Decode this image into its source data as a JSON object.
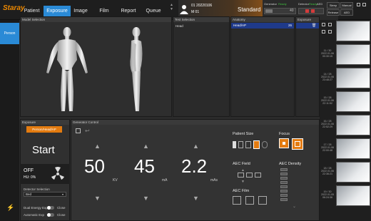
{
  "app": {
    "logo": "Staray"
  },
  "nav": {
    "tabs": [
      "Patient",
      "Exposure",
      "Image",
      "Film",
      "Report",
      "Queue"
    ],
    "active": "Exposure"
  },
  "patient": {
    "line1": "01  20220106",
    "line2": "M  01",
    "protocol": "Standard"
  },
  "status": {
    "generator_label": "Generator",
    "generator_state": "Ready",
    "detector_label": "Detector",
    "detector_state": "Ready",
    "detector_value": "AED",
    "counter": "40",
    "sleep": "Sleep",
    "manual": "Manual",
    "release": "Release",
    "aed": "AED"
  },
  "sidebar": {
    "person_label": "Person"
  },
  "model_selection": {
    "title": "Model Selection"
  },
  "test_selection": {
    "title": "Test Selection",
    "items": [
      "Head"
    ]
  },
  "anatomy": {
    "title": "Anatomy",
    "items": [
      {
        "label": "Head/AP",
        "count": "26"
      }
    ]
  },
  "exposure_list": {
    "title": "Exposure"
  },
  "exposure_panel": {
    "title": "Exposure",
    "protocol_tag": "Person/Head/AP",
    "start_label": "Start",
    "state": "OFF",
    "hu": "HU: 0%",
    "detector_selection_label": "Detector Selection",
    "detector_value": "Bed",
    "dual_energy_label": "Dual Energy Exp",
    "dual_energy_state": "Close",
    "automatic_label": "Automatic Exp",
    "automatic_state": "Close"
  },
  "generator": {
    "title": "Generator Control",
    "kv": {
      "value": "50",
      "unit": "KV"
    },
    "ma": {
      "value": "45",
      "unit": "mA"
    },
    "mas": {
      "value": "2.2",
      "unit": "mAs"
    }
  },
  "controls": {
    "patient_size": "Patient Size",
    "focus": "Focus",
    "aec_field": "AEC Field",
    "aec_density": "AEC Density",
    "aec_film": "AEC Film"
  },
  "thumbnails": [
    {
      "id": "11 / 30",
      "date": "2022.01.06",
      "time": "00:30:15"
    },
    {
      "id": "14 / 28",
      "date": "2022.01.06",
      "time": "23:48:27"
    },
    {
      "id": "15 / 28",
      "date": "2022.01.06",
      "time": "22:11:52"
    },
    {
      "id": "16 / 28",
      "date": "2022.01.06",
      "time": "22:52:29"
    },
    {
      "id": "17 / 28",
      "date": "2022.01.06",
      "time": "22:00:48"
    },
    {
      "id": "18 / 28",
      "date": "2022.01.06",
      "time": "22:36:21"
    },
    {
      "id": "19 / 30",
      "date": "2022.01.05",
      "time": "06:24:36"
    }
  ],
  "colors": {
    "accent": "#2a8ad6",
    "orange": "#e37b10",
    "ready": "#3fbf3f"
  }
}
